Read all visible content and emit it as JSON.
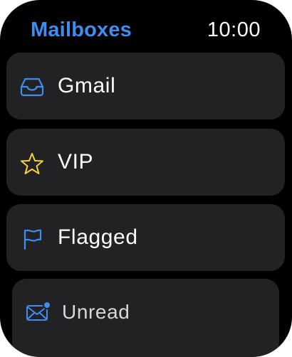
{
  "header": {
    "title": "Mailboxes",
    "time": "10:00"
  },
  "mailboxes": [
    {
      "label": "Gmail",
      "icon": "inbox-tray-icon",
      "icon_color": "#3d8ef0"
    },
    {
      "label": "VIP",
      "icon": "star-icon",
      "icon_color": "#f4d33a"
    },
    {
      "label": "Flagged",
      "icon": "flag-icon",
      "icon_color": "#3d8ef0"
    },
    {
      "label": "Unread",
      "icon": "unread-envelope-icon",
      "icon_color": "#3d8ef0"
    }
  ],
  "colors": {
    "accent": "#3d8ef0",
    "vip": "#f4d33a",
    "card": "#222224",
    "background": "#000000"
  }
}
